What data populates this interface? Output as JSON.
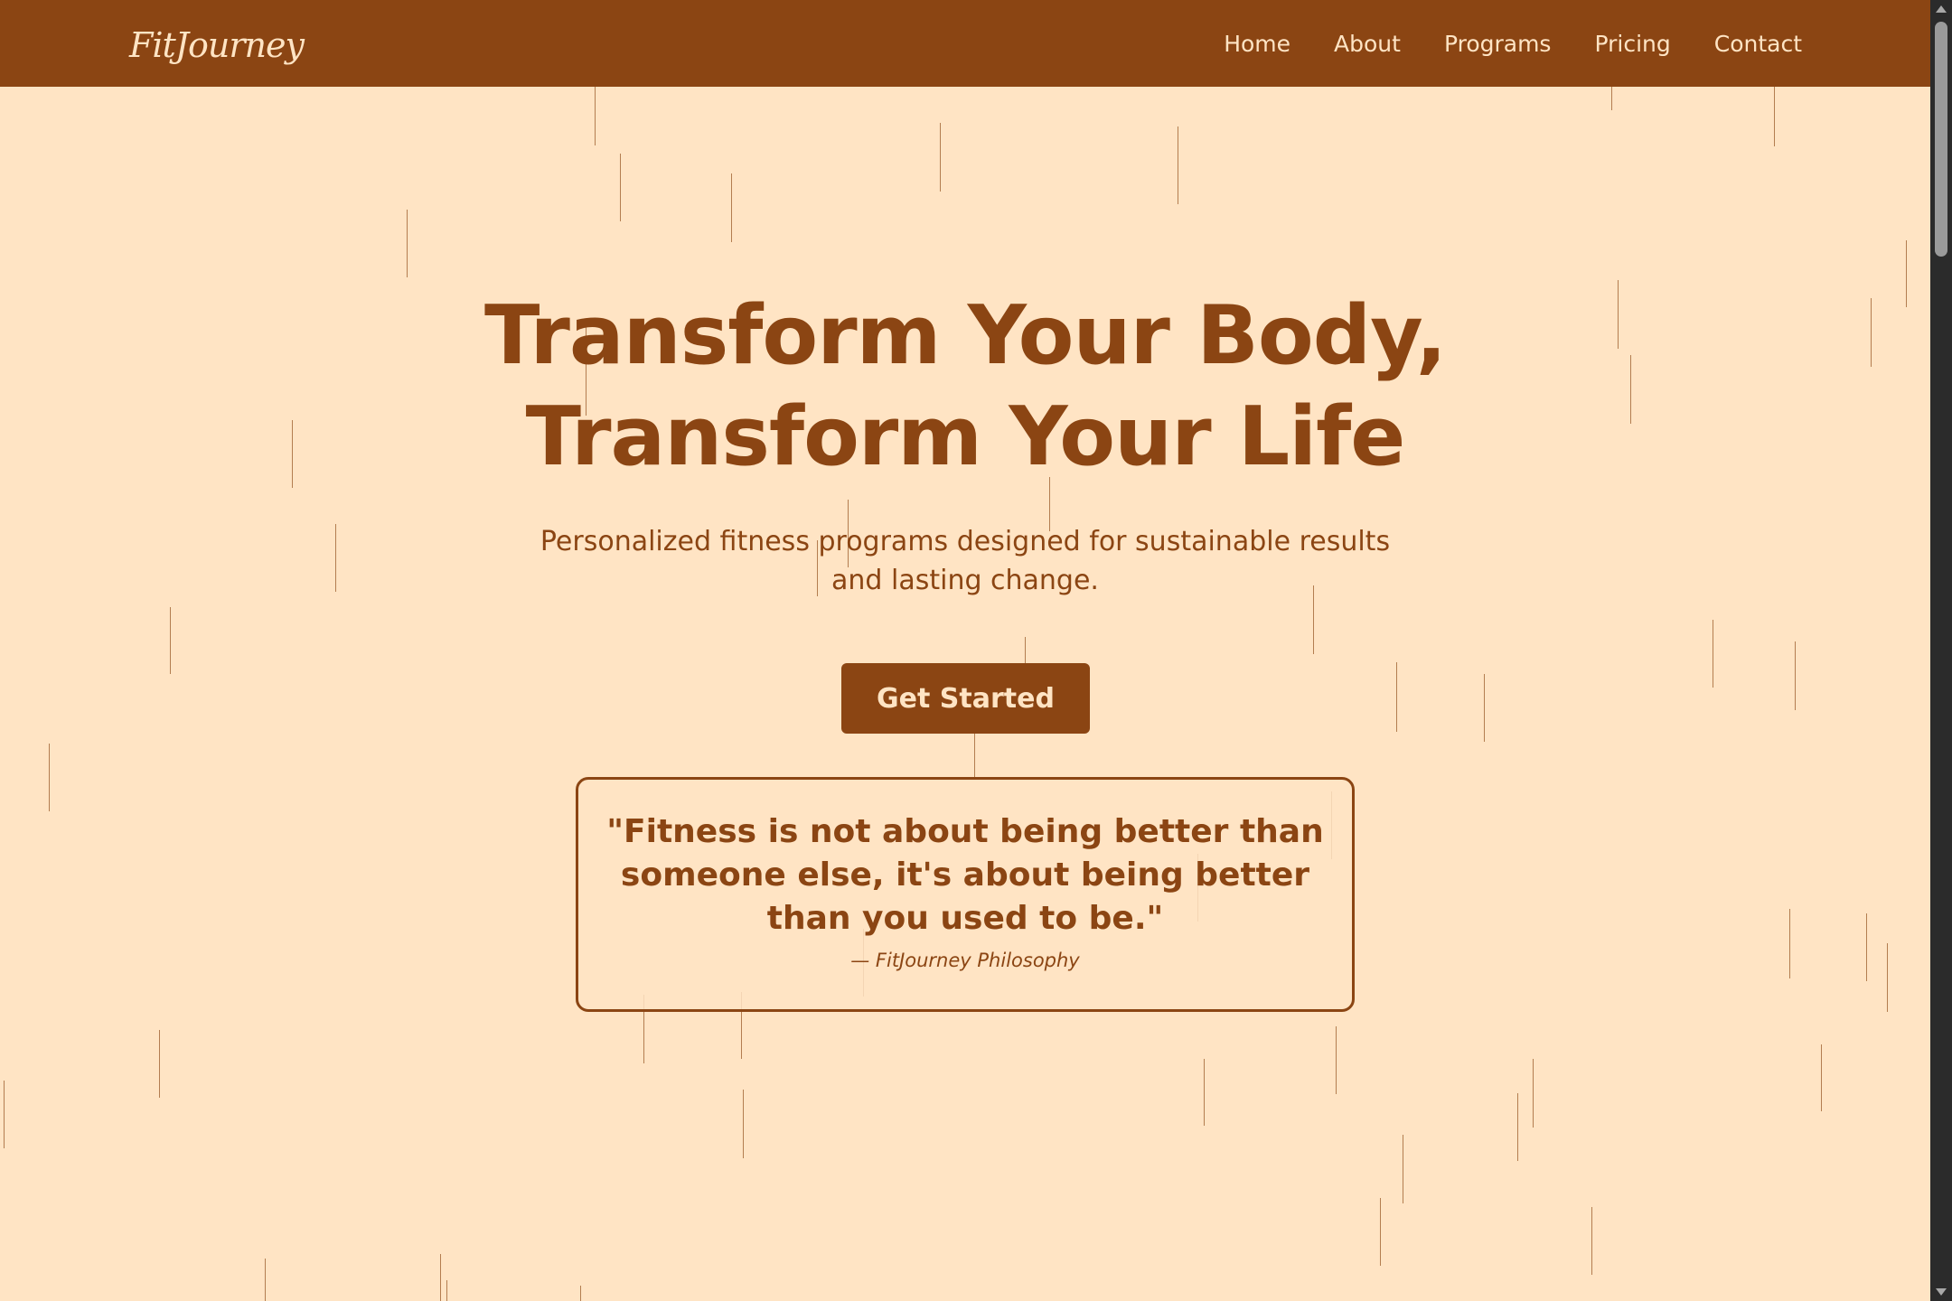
{
  "nav": {
    "logo": "FitJourney",
    "links": [
      "Home",
      "About",
      "Programs",
      "Pricing",
      "Contact"
    ]
  },
  "hero": {
    "title_line1": "Transform Your Body,",
    "title_line2": "Transform Your Life",
    "subtitle": "Personalized fitness programs designed for sustainable results and lasting change.",
    "cta_label": "Get Started"
  },
  "quote": {
    "text": "\"Fitness is not about being better than someone else, it's about being better than you used to be.\"",
    "author": "— FitJourney Philosophy"
  },
  "colors": {
    "brand_brown": "#8B4513",
    "background_cream": "#FFE4C4"
  }
}
